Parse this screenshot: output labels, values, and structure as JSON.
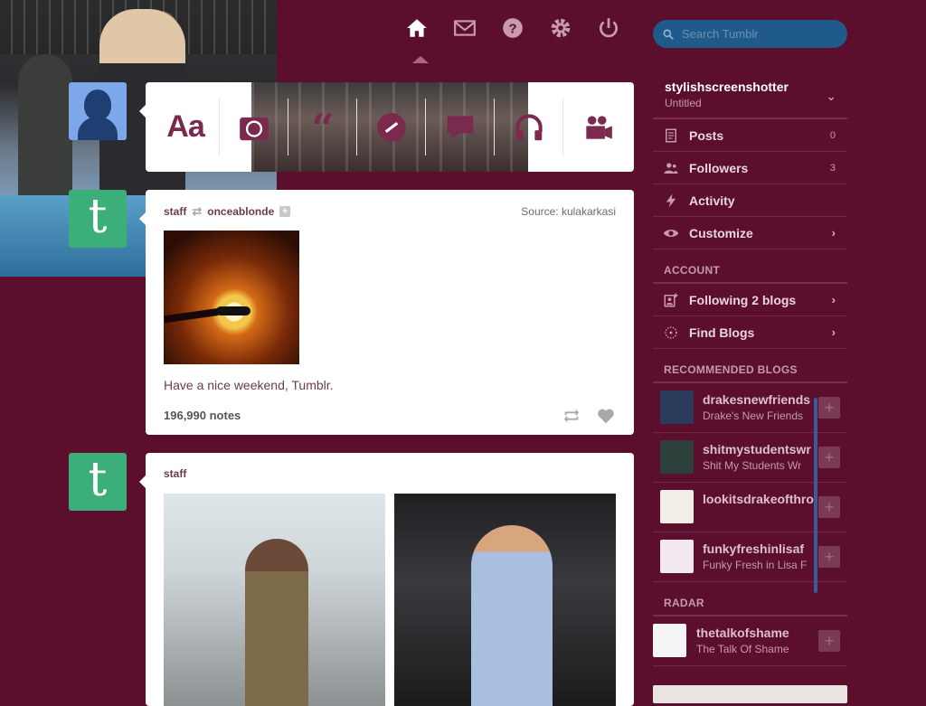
{
  "nav": {
    "icons": [
      "home-icon",
      "mail-icon",
      "help-icon",
      "gear-icon",
      "power-icon"
    ],
    "search_placeholder": "Search Tumblr"
  },
  "post_types": [
    "Text",
    "Photo",
    "Quote",
    "Link",
    "Chat",
    "Audio",
    "Video"
  ],
  "post_types_text_label": "Aa",
  "posts": [
    {
      "author": "staff",
      "reblogged_from": "onceablonde",
      "source_label": "Source:",
      "source": "kulakarkasi",
      "caption": "Have a nice weekend, Tumblr.",
      "notes": "196,990 notes"
    },
    {
      "author": "staff"
    }
  ],
  "avatar_letter": "t",
  "account": {
    "name": "stylishscreenshotter",
    "subtitle": "Untitled",
    "chevron": "⌄"
  },
  "menu": [
    {
      "label": "Posts",
      "count": "0",
      "icon": "posts-icon"
    },
    {
      "label": "Followers",
      "count": "3",
      "icon": "followers-icon"
    },
    {
      "label": "Activity",
      "icon": "lightning-icon"
    },
    {
      "label": "Customize",
      "chevron": "›",
      "icon": "eye-icon"
    }
  ],
  "account_section": {
    "title": "ACCOUNT",
    "items": [
      {
        "label": "Following 2 blogs",
        "chevron": "›",
        "icon": "following-icon"
      },
      {
        "label": "Find Blogs",
        "chevron": "›",
        "icon": "find-blogs-icon"
      }
    ]
  },
  "recommended": {
    "title": "RECOMMENDED BLOGS",
    "items": [
      {
        "name": "drakesnewfriends",
        "subtitle": "Drake's New Friends",
        "thumb_color": "#2a3a5a"
      },
      {
        "name": "shitmystudentswr",
        "subtitle": "Shit My Students Wr",
        "thumb_color": "#2c3f3a"
      },
      {
        "name": "lookitsdrakeofthro",
        "subtitle": "",
        "thumb_color": "#f2ede6"
      },
      {
        "name": "funkyfreshinlisaf",
        "subtitle": "Funky Fresh in Lisa F",
        "thumb_color": "#f4e8f0"
      }
    ],
    "follow_label": "+"
  },
  "radar": {
    "title": "RADAR",
    "name": "thetalkofshame",
    "subtitle": "The Talk Of Shame"
  }
}
